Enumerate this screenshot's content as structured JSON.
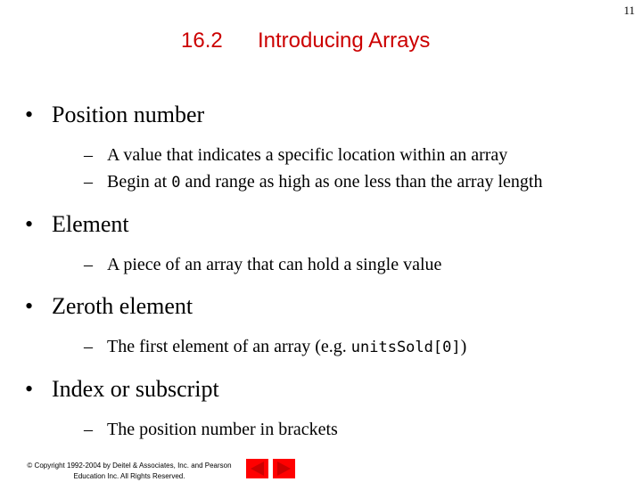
{
  "page_number": "11",
  "title": {
    "section": "16.2",
    "text": "Introducing Arrays"
  },
  "bullets": [
    {
      "label": "Position number",
      "subs": [
        {
          "parts": [
            {
              "t": "A value that indicates a specific location within an array"
            }
          ]
        },
        {
          "parts": [
            {
              "t": "Begin at "
            },
            {
              "code": "0"
            },
            {
              "t": " and range as high as one less than the array length"
            }
          ]
        }
      ]
    },
    {
      "label": "Element",
      "subs": [
        {
          "parts": [
            {
              "t": "A piece of an array that can hold a single value"
            }
          ]
        }
      ]
    },
    {
      "label": "Zeroth element",
      "subs": [
        {
          "parts": [
            {
              "t": "The first element of an array (e.g. "
            },
            {
              "code": "unitsSold[0]"
            },
            {
              "t": ")"
            }
          ]
        }
      ]
    },
    {
      "label": "Index or subscript",
      "subs": [
        {
          "parts": [
            {
              "t": "The position number in brackets"
            }
          ]
        }
      ]
    }
  ],
  "bullet_glyph": "•",
  "dash_glyph": "–",
  "footer": {
    "line1": "© Copyright 1992-2004 by Deitel & Associates, Inc. and Pearson",
    "line2": "Education Inc. All Rights Reserved."
  },
  "nav": {
    "prev_icon": "prev-arrow-icon",
    "next_icon": "next-arrow-icon",
    "color": "#ff0000",
    "arrow_color": "#cc0000"
  }
}
